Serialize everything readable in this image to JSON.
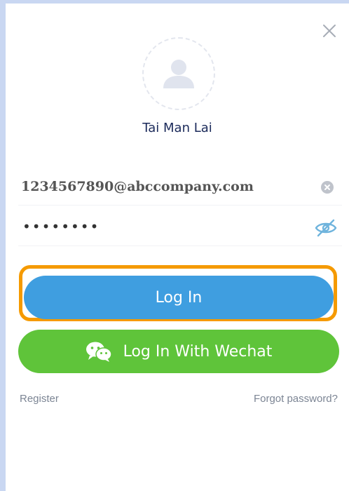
{
  "profile": {
    "username": "Tai Man Lai",
    "avatar_icon": "user-silhouette-icon"
  },
  "form": {
    "email_value": "1234567890@abccompany.com",
    "password_value": "••••••••",
    "clear_icon": "clear-circle-icon",
    "visibility_icon": "eye-off-icon"
  },
  "actions": {
    "login_label": "Log In",
    "wechat_label": "Log In With Wechat",
    "register_label": "Register",
    "forgot_label": "Forgot password?"
  },
  "colors": {
    "login_button": "#3f9ee0",
    "wechat_button": "#5fc43a",
    "highlight": "#f59a00",
    "username_text": "#1b2a5a"
  }
}
